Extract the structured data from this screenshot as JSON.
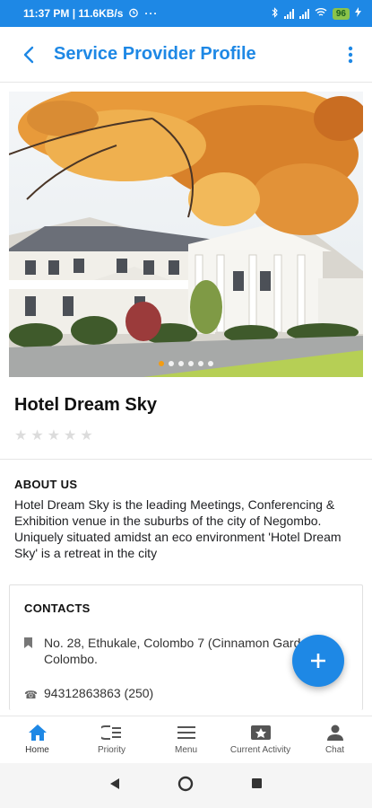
{
  "status_bar": {
    "time_speed": "11:37 PM | 11.6KB/s",
    "battery": "96"
  },
  "app_bar": {
    "title": "Service Provider Profile"
  },
  "provider": {
    "name": "Hotel Dream Sky",
    "rating": 0,
    "rating_max": 5
  },
  "carousel": {
    "total_slides": 6,
    "active_slide": 1
  },
  "about": {
    "heading": "ABOUT US",
    "text": "Hotel Dream Sky is the leading Meetings, Conferencing & Exhibition venue in the suburbs of the city of Negombo. Uniquely situated amidst an eco environment 'Hotel Dream Sky' is a retreat in the city"
  },
  "contacts": {
    "heading": "CONTACTS",
    "address": "No. 28, Ethukale, Colombo 7 (Cinnamon Gardens), Colombo.",
    "phone": "94312863863 (250)"
  },
  "bottom_nav": {
    "items": [
      {
        "label": "Home",
        "icon": "home-icon"
      },
      {
        "label": "Priority",
        "icon": "priority-icon"
      },
      {
        "label": "Menu",
        "icon": "menu-icon"
      },
      {
        "label": "Current Activity",
        "icon": "activity-icon"
      },
      {
        "label": "Chat",
        "icon": "person-icon"
      }
    ]
  },
  "colors": {
    "primary": "#1e88e5",
    "indicator_active": "#f39c12"
  }
}
